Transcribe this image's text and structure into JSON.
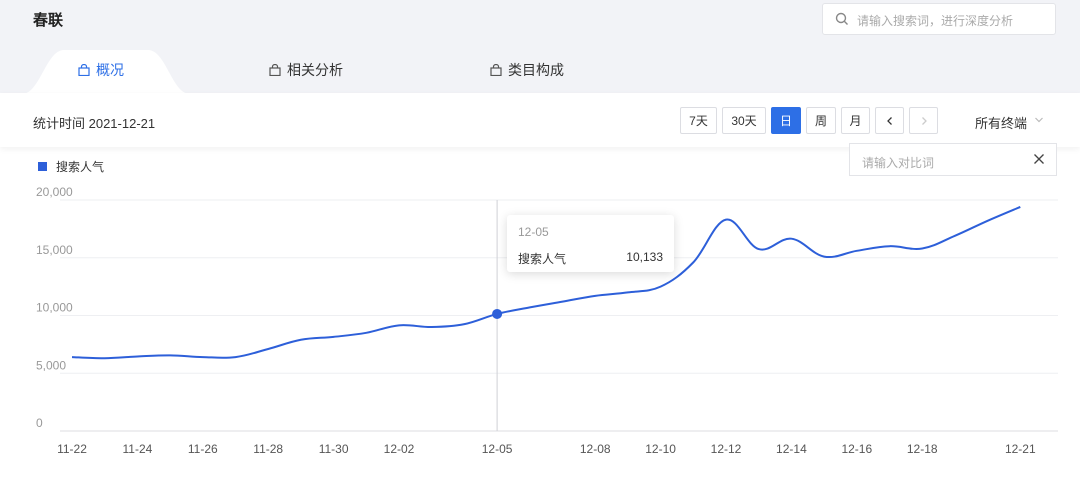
{
  "header": {
    "keyword": "春联",
    "search_placeholder": "请输入搜索词，进行深度分析"
  },
  "tabs": [
    {
      "label": "概况",
      "active": true
    },
    {
      "label": "相关分析",
      "active": false
    },
    {
      "label": "类目构成",
      "active": false
    }
  ],
  "stat": {
    "time_label": "统计时间 2021-12-21",
    "ranges": [
      "7天",
      "30天",
      "日",
      "周",
      "月"
    ],
    "active_range": "日",
    "terminal": "所有终端"
  },
  "compare_placeholder": "请输入对比词",
  "colors": {
    "accent": "#2d6fe6",
    "line": "#2d5fd9"
  },
  "tooltip": {
    "date": "12-05",
    "name": "搜索人气",
    "value": "10,133"
  },
  "chart_data": {
    "type": "line",
    "series": [
      {
        "name": "搜索人气",
        "x": [
          "11-22",
          "11-23",
          "11-24",
          "11-25",
          "11-26",
          "11-27",
          "11-28",
          "11-29",
          "11-30",
          "12-01",
          "12-02",
          "12-03",
          "12-04",
          "12-05",
          "12-06",
          "12-07",
          "12-08",
          "12-09",
          "12-10",
          "12-11",
          "12-12",
          "12-13",
          "12-14",
          "12-15",
          "12-16",
          "12-17",
          "12-18",
          "12-19",
          "12-20",
          "12-21"
        ],
        "values": [
          6400,
          6300,
          6450,
          6550,
          6400,
          6400,
          7100,
          7900,
          8150,
          8500,
          9150,
          9000,
          9250,
          10133,
          10700,
          11200,
          11700,
          12000,
          12500,
          14600,
          18300,
          15750,
          16650,
          15100,
          15600,
          16000,
          15800,
          16900,
          18200,
          19400
        ]
      }
    ],
    "x_tick_labels": [
      "11-22",
      "11-24",
      "11-26",
      "11-28",
      "11-30",
      "12-02",
      "12-05",
      "12-08",
      "12-10",
      "12-12",
      "12-14",
      "12-16",
      "12-18",
      "12-21"
    ],
    "y_tick_labels": [
      "0",
      "5,000",
      "10,000",
      "15,000",
      "20,000"
    ],
    "ylim": [
      0,
      20000
    ],
    "grid": true,
    "legend": "top-left",
    "highlight_index": 13
  }
}
